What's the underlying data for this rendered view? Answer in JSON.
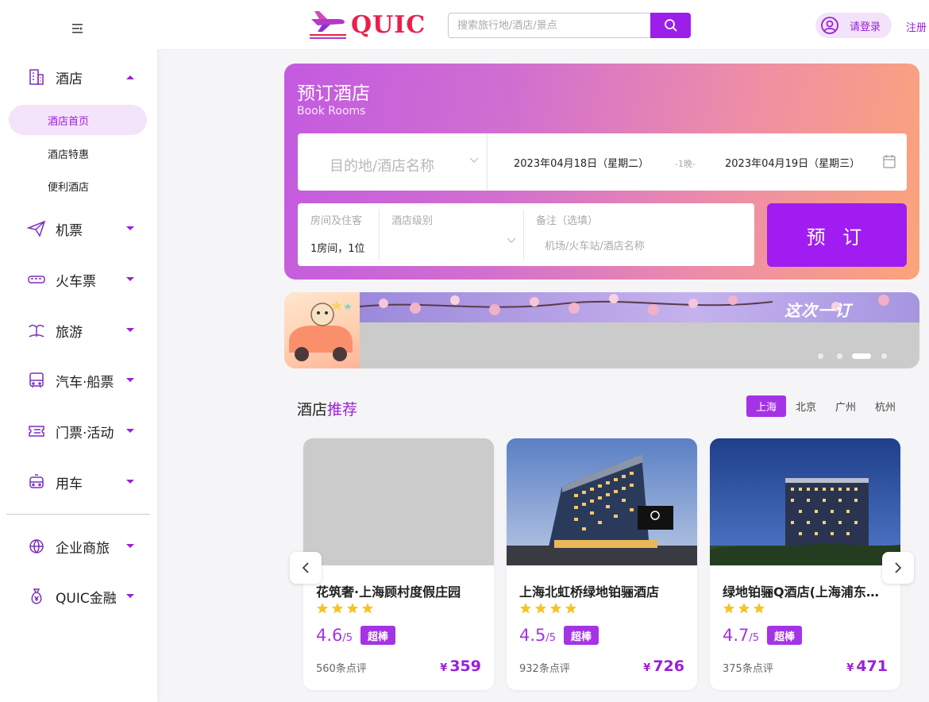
{
  "header": {
    "brand": "QUIC",
    "search_placeholder": "搜索旅行地/酒店/景点",
    "login_label": "请登录",
    "register_label": "注册"
  },
  "sidebar": {
    "items": [
      {
        "label": "酒店",
        "icon": "hotel-building-icon"
      },
      {
        "label": "机票",
        "icon": "paper-plane-icon"
      },
      {
        "label": "火车票",
        "icon": "train-icon"
      },
      {
        "label": "旅游",
        "icon": "palm-island-icon"
      },
      {
        "label": "汽车·船票",
        "icon": "bus-icon"
      },
      {
        "label": "门票·活动",
        "icon": "ticket-icon"
      },
      {
        "label": "用车",
        "icon": "car-icon"
      },
      {
        "label": "企业商旅",
        "icon": "business-globe-icon"
      },
      {
        "label": "QUIC金融",
        "icon": "money-bag-icon"
      }
    ],
    "hotel_sub": [
      "酒店首页",
      "酒店特惠",
      "便利酒店"
    ],
    "active_sub": "酒店首页"
  },
  "booking": {
    "title": "预订酒店",
    "subtitle": "Book Rooms",
    "destination_placeholder": "目的地/酒店名称",
    "checkin": "2023年04月18日（星期二）",
    "nights": "-1晚-",
    "checkout": "2023年04月19日（星期三）",
    "rooms_label": "房间及住客",
    "rooms_value": "1房间，1位",
    "level_label": "酒店级别",
    "remark_label": "备注（选填）",
    "remark_placeholder": "机场/火车站/酒店名称",
    "submit": "预 订"
  },
  "banner": {
    "text": "这次一订",
    "slide_count": 4,
    "active_slide": 3
  },
  "recommend": {
    "title_prefix": "酒店",
    "title_highlight": "推荐",
    "cities": [
      "上海",
      "北京",
      "广州",
      "杭州"
    ],
    "active_city": "上海",
    "hotels": [
      {
        "name": "花筑奢·上海顾村度假庄园",
        "stars": 4,
        "score": "4.6",
        "score_max": "/5",
        "badge": "超棒",
        "reviews": "560条点评",
        "currency": "¥",
        "price": "359"
      },
      {
        "name": "上海北虹桥绿地铂骊酒店",
        "stars": 4,
        "score": "4.5",
        "score_max": "/5",
        "badge": "超棒",
        "reviews": "932条点评",
        "currency": "¥",
        "price": "726"
      },
      {
        "name": "绿地铂骊Q酒店(上海浦东…",
        "stars": 3,
        "score": "4.7",
        "score_max": "/5",
        "badge": "超棒",
        "reviews": "375条点评",
        "currency": "¥",
        "price": "471"
      }
    ]
  },
  "colors": {
    "accent": "#9b1fd9",
    "button": "#a01cf0",
    "brand_red": "#e8204d",
    "star": "#f7c325"
  }
}
